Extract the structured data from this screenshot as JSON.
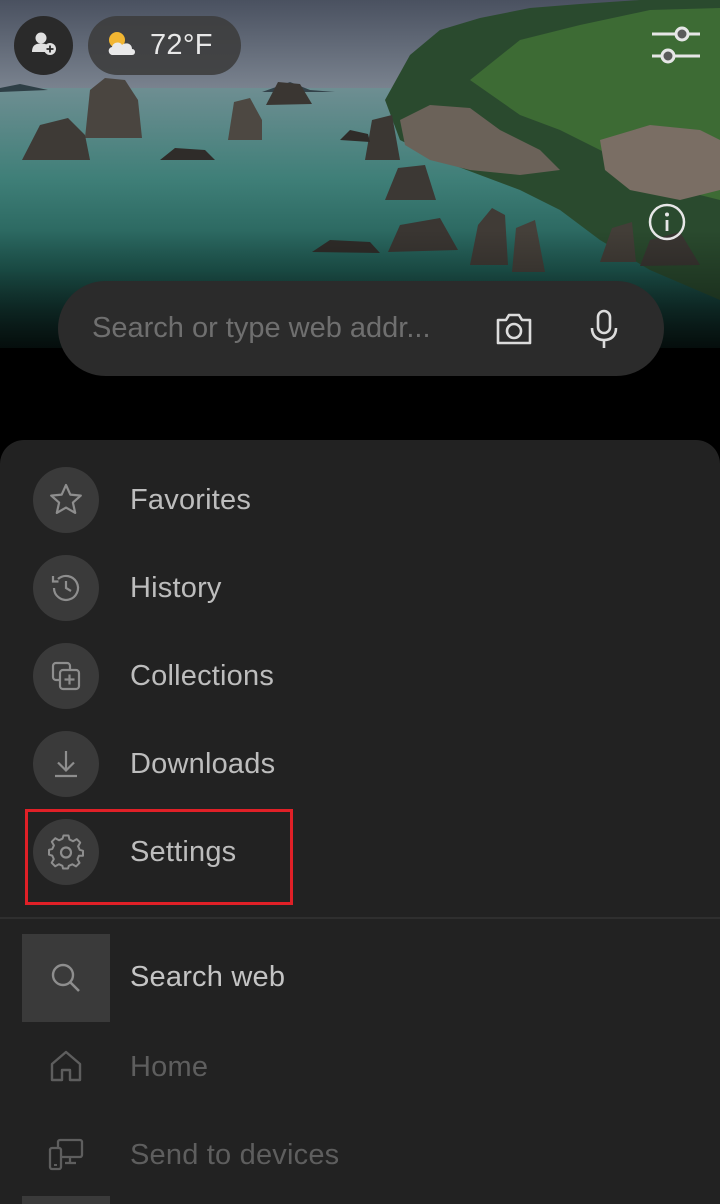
{
  "weather": {
    "temperature": "72°F",
    "icon": "partly-cloudy-icon"
  },
  "search": {
    "placeholder": "Search or type web addr..."
  },
  "menu": {
    "items": [
      {
        "label": "Favorites",
        "icon": "star-icon"
      },
      {
        "label": "History",
        "icon": "history-icon"
      },
      {
        "label": "Collections",
        "icon": "collections-icon"
      },
      {
        "label": "Downloads",
        "icon": "download-icon"
      },
      {
        "label": "Settings",
        "icon": "gear-icon",
        "highlighted": true
      }
    ],
    "secondary": [
      {
        "label": "Search web",
        "icon": "search-icon",
        "active": true
      },
      {
        "label": "Home",
        "icon": "home-icon"
      },
      {
        "label": "Send to devices",
        "icon": "devices-icon"
      }
    ]
  },
  "colors": {
    "sheet_background": "#222222",
    "highlight": "#e02027",
    "icon_circle": "#3a3a3a"
  }
}
